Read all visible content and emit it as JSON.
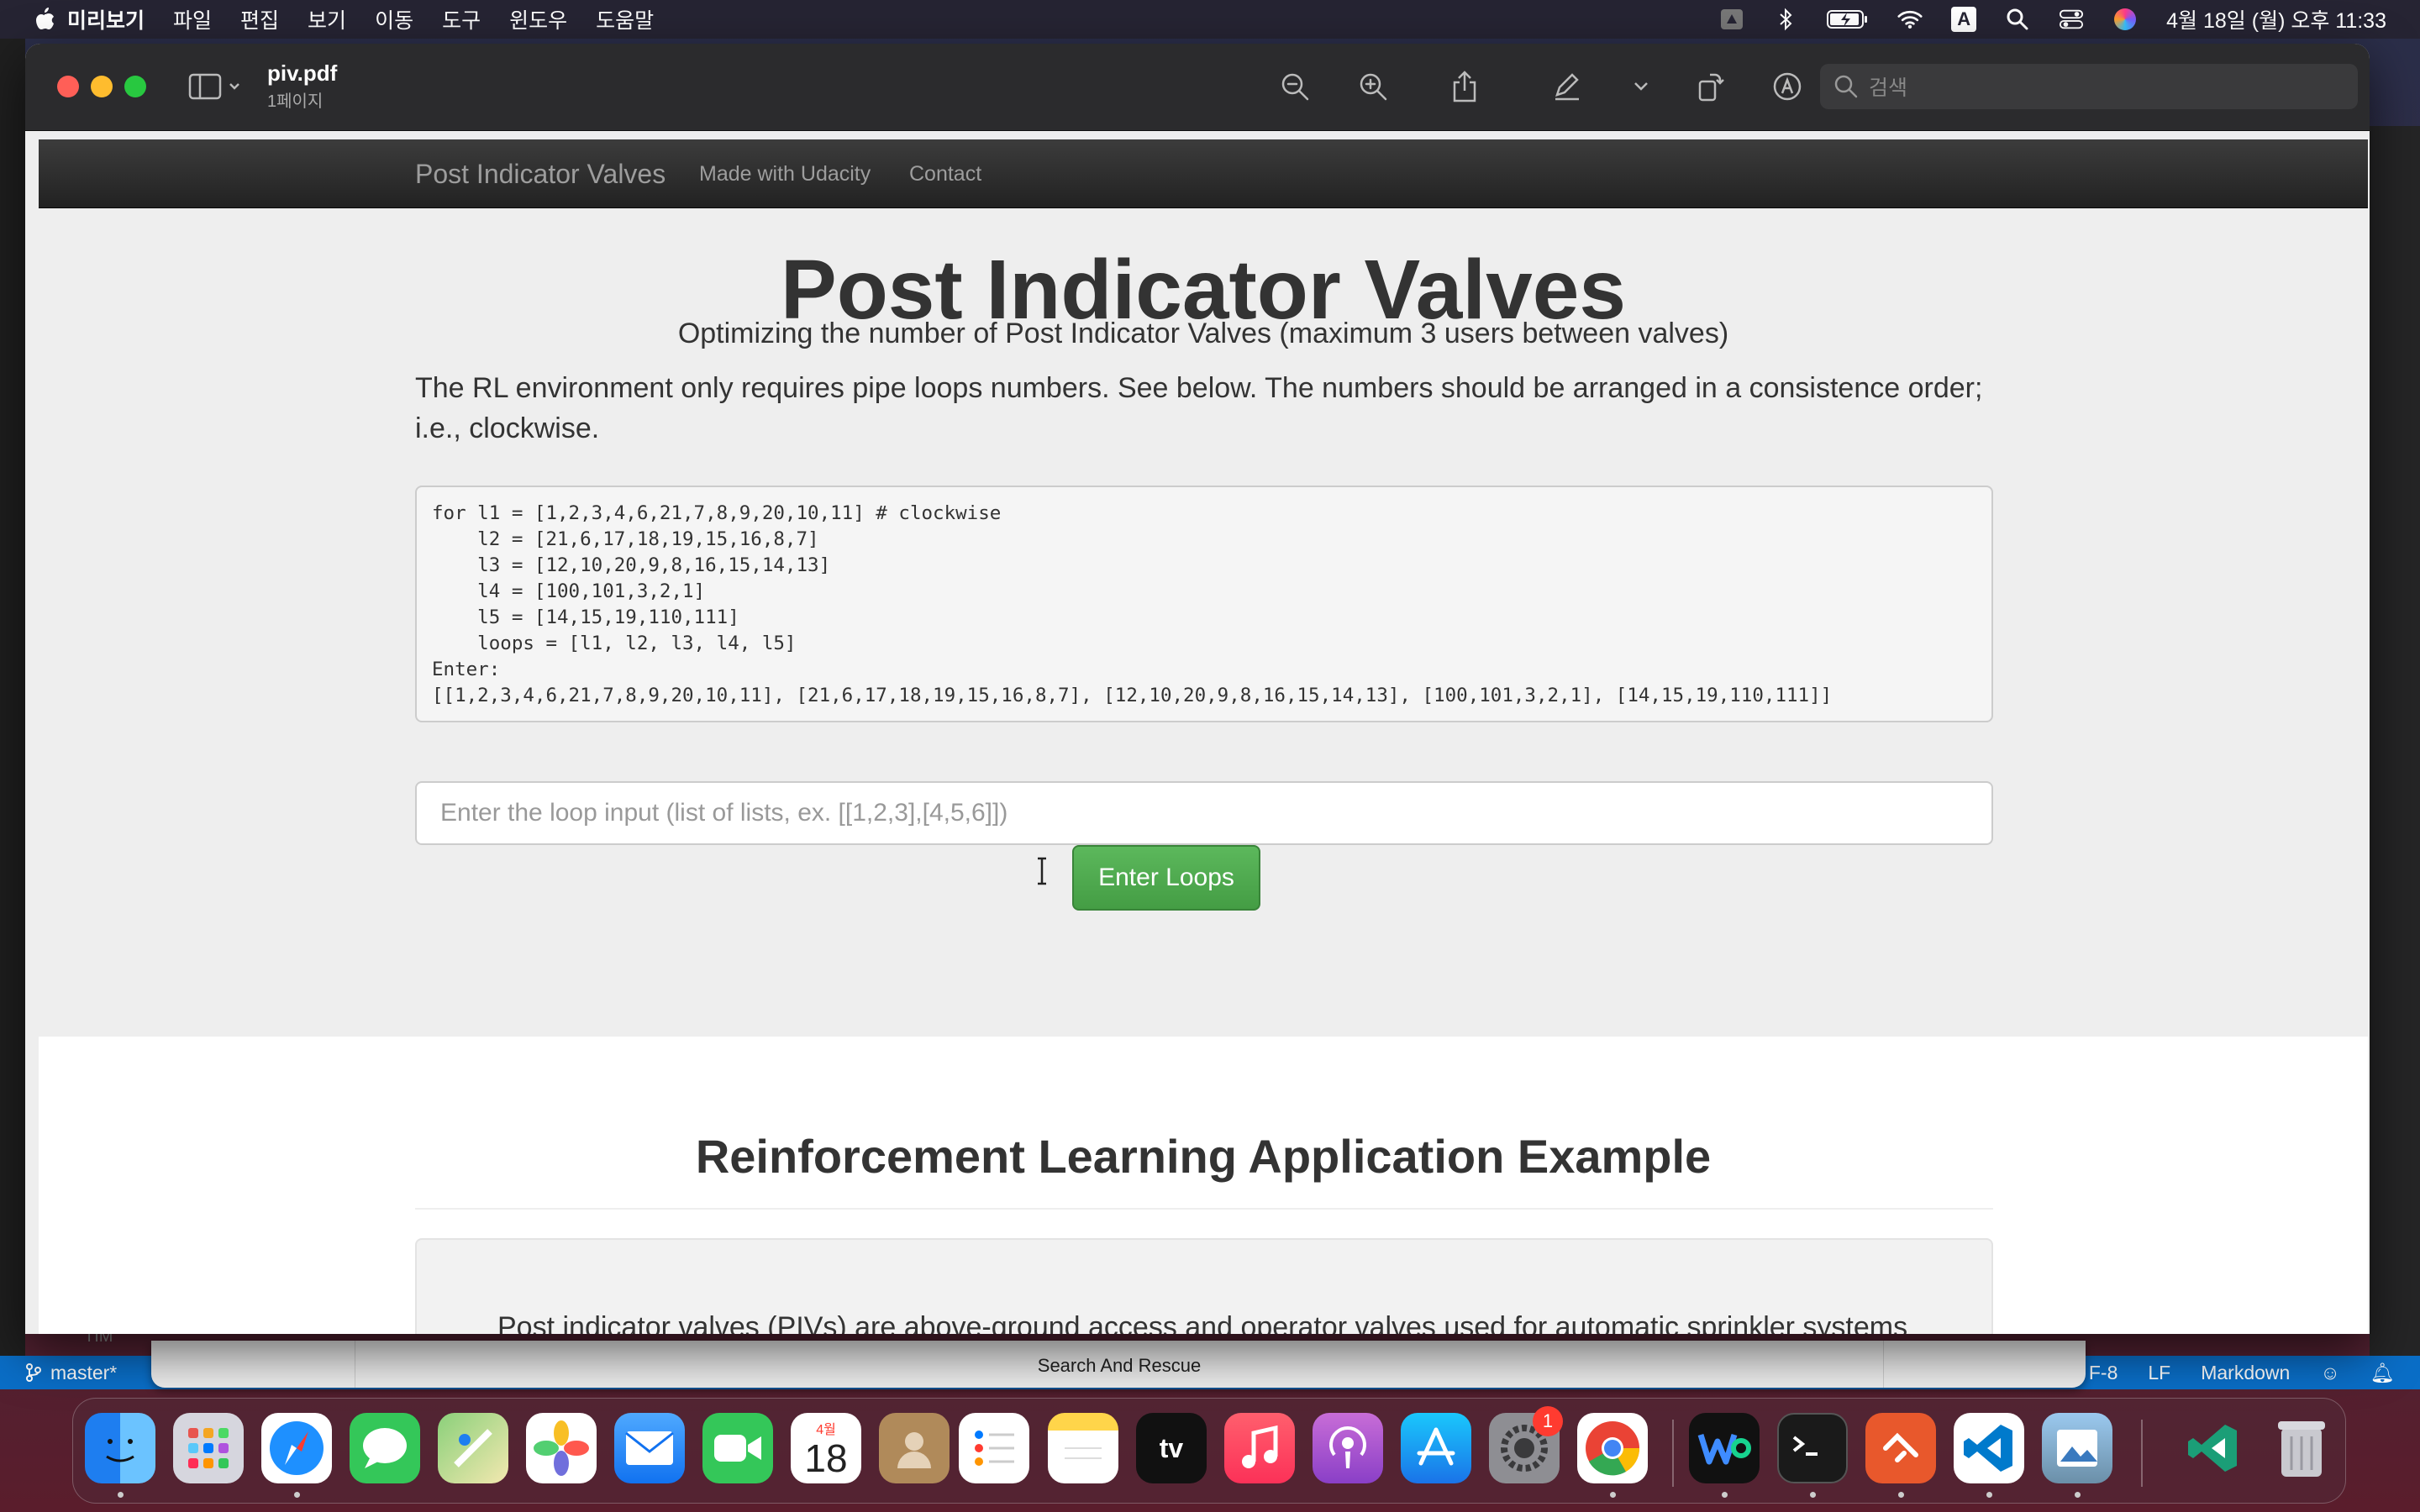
{
  "menubar": {
    "app_name": "미리보기",
    "items": [
      "파일",
      "편집",
      "보기",
      "이동",
      "도구",
      "윈도우",
      "도움말"
    ],
    "input_indicator": "A",
    "clock": "4월 18일 (월) 오후 11:33"
  },
  "window": {
    "doc_title": "piv.pdf",
    "doc_subtitle": "1페이지",
    "search_placeholder": "검색"
  },
  "navbar": {
    "brand": "Post Indicator Valves",
    "links": [
      "Made with Udacity",
      "Contact"
    ]
  },
  "jumbotron": {
    "title": "Post Indicator Valves",
    "lead": "Optimizing the number of Post Indicator Valves (maximum 3 users between valves)",
    "paragraph": "The RL environment only requires pipe loops numbers. See below. The numbers should be arranged in a consistence order; i.e., clockwise.",
    "code_lines": [
      "for l1 = [1,2,3,4,6,21,7,8,9,20,10,11] # clockwise",
      "    l2 = [21,6,17,18,19,15,16,8,7]",
      "    l3 = [12,10,20,9,8,16,15,14,13]",
      "    l4 = [100,101,3,2,1]",
      "    l5 = [14,15,19,110,111]",
      "    loops = [l1, l2, l3, l4, l5]",
      "Enter:",
      "[[1,2,3,4,6,21,7,8,9,20,10,11], [21,6,17,18,19,15,16,8,7], [12,10,20,9,8,16,15,14,13], [100,101,3,2,1], [14,15,19,110,111]]"
    ],
    "input_placeholder": "Enter the loop input (list of lists, ex. [[1,2,3],[4,5,6]])",
    "button_label": "Enter Loops"
  },
  "section": {
    "heading": "Reinforcement Learning Application Example",
    "text": "Post indicator valves (PIVs) are above-ground access and operator valves used for automatic sprinkler systems and wet standpipe systems whose main water supply valves are located underground. PIVs may be placed in either a"
  },
  "background": {
    "statusbar": {
      "branch": "master*",
      "encoding": "F-8",
      "line_ending": "LF",
      "language": "Markdown"
    },
    "bottom_window_title": "Search And Rescue",
    "timeline_label": "TIM"
  },
  "dock": {
    "calendar_month": "4월",
    "calendar_day": "18",
    "settings_badge": "1",
    "tv_label": "tv",
    "apps": [
      "finder",
      "launchpad",
      "safari",
      "messages",
      "maps",
      "photos",
      "mail",
      "facetime",
      "calendar",
      "contacts",
      "reminders",
      "notes",
      "tv",
      "music",
      "podcasts",
      "app-store",
      "system-preferences",
      "chrome",
      "webex",
      "terminal",
      "remote-desktop",
      "vscode",
      "preview",
      "vscode-insiders",
      "trash"
    ]
  }
}
